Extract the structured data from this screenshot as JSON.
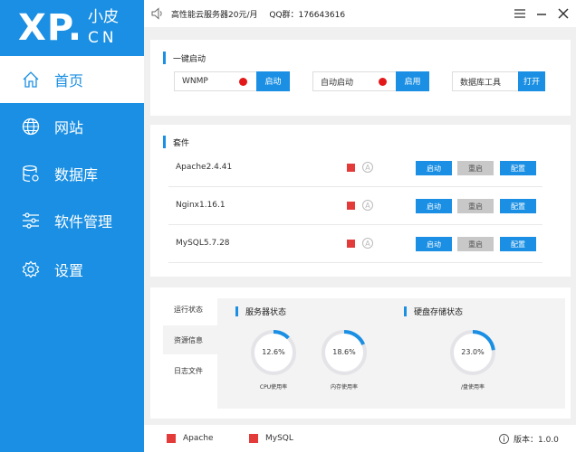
{
  "logo": {
    "main": "XP.",
    "zh": "小皮",
    "cn": "CN"
  },
  "nav": [
    {
      "label": "首页",
      "icon": "home-icon",
      "active": true
    },
    {
      "label": "网站",
      "icon": "globe-icon"
    },
    {
      "label": "数据库",
      "icon": "database-icon"
    },
    {
      "label": "软件管理",
      "icon": "sliders-icon"
    },
    {
      "label": "设置",
      "icon": "gear-icon"
    }
  ],
  "topbar": {
    "announcement": "高性能云服务器20元/月",
    "qq": "QQ群：176643616"
  },
  "quick_start": {
    "title": "一键启动",
    "items": [
      {
        "text": "WNMP",
        "button": "启动",
        "status_color": "#e31919"
      },
      {
        "text": "自动启动",
        "button": "启用",
        "status_color": "#e31919"
      },
      {
        "text": "数据库工具",
        "button": "打开"
      }
    ]
  },
  "suites": {
    "title": "套件",
    "rows": [
      {
        "name": "Apache2.4.41"
      },
      {
        "name": "Nginx1.16.1"
      },
      {
        "name": "MySQL5.7.28"
      }
    ],
    "auto_glyph": "A",
    "start_label": "启动",
    "restart_label": "重启",
    "config_label": "配置"
  },
  "status": {
    "tabs": [
      "运行状态",
      "资源信息",
      "日志文件"
    ],
    "server_title": "服务器状态",
    "disk_title": "硬盘存储状态",
    "gauges": [
      {
        "value": "12.6%",
        "fraction": 0.126,
        "caption": "CPU使用率"
      },
      {
        "value": "18.6%",
        "fraction": 0.186,
        "caption": "内存使用率"
      },
      {
        "value": "23.0%",
        "fraction": 0.23,
        "caption": "/盘使用率"
      }
    ]
  },
  "footer": {
    "apache": "Apache",
    "mysql": "MySQL",
    "version": "版本：1.0.0"
  },
  "colors": {
    "accent": "#1a8fe3",
    "status_red": "#e33a3a"
  }
}
